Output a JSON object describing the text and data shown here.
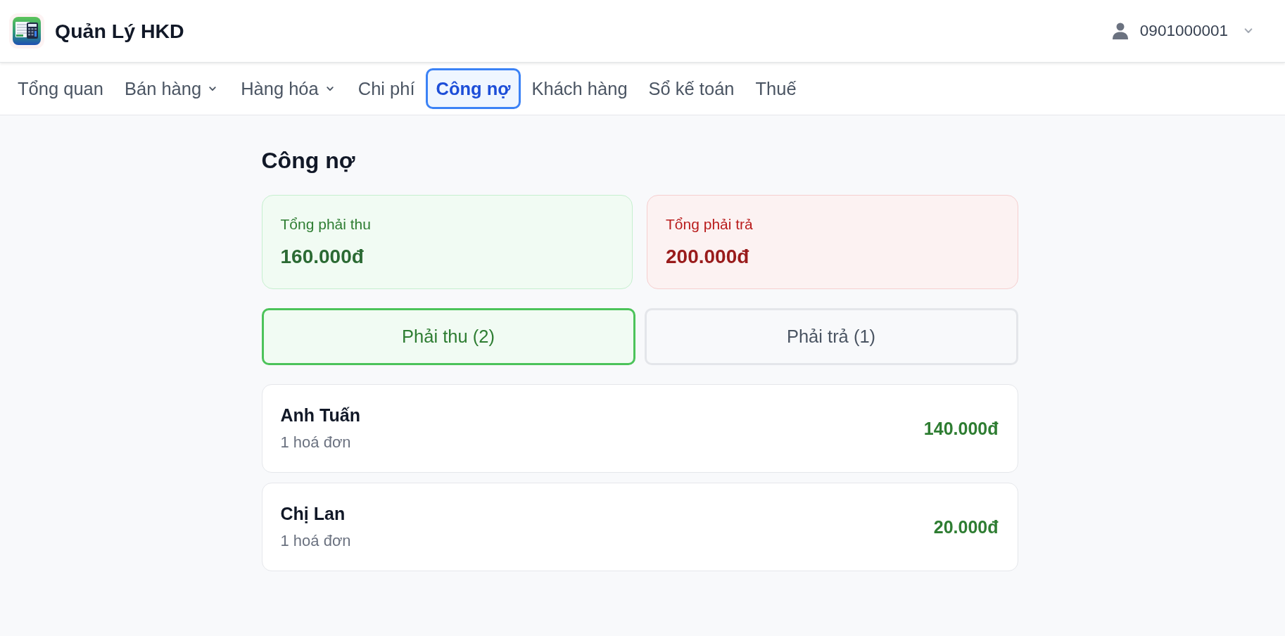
{
  "header": {
    "app_title": "Quản Lý HKD",
    "user": {
      "phone": "0901000001"
    }
  },
  "nav": {
    "items": [
      {
        "label": "Tổng quan",
        "selected": false,
        "has_menu": false
      },
      {
        "label": "Bán hàng",
        "selected": false,
        "has_menu": true
      },
      {
        "label": "Hàng hóa",
        "selected": false,
        "has_menu": true
      },
      {
        "label": "Chi phí",
        "selected": false,
        "has_menu": false
      },
      {
        "label": "Công nợ",
        "selected": true,
        "has_menu": false
      },
      {
        "label": "Khách hàng",
        "selected": false,
        "has_menu": false
      },
      {
        "label": "Sổ kế toán",
        "selected": false,
        "has_menu": false
      },
      {
        "label": "Thuế",
        "selected": false,
        "has_menu": false
      }
    ]
  },
  "page": {
    "title": "Công nợ"
  },
  "summary_cards": [
    {
      "kind": "receivable",
      "label": "Tổng phải thu",
      "value": "160.000đ"
    },
    {
      "kind": "payable",
      "label": "Tổng phải trả",
      "value": "200.000đ"
    }
  ],
  "tabs": [
    {
      "label": "Phải thu (2)",
      "selected": true
    },
    {
      "label": "Phải trả (1)",
      "selected": false
    }
  ],
  "debtors": [
    {
      "name": "Anh Tuấn",
      "invoices": "1 hoá đơn",
      "amount": "140.000đ"
    },
    {
      "name": "Chị Lan",
      "invoices": "1 hoá đơn",
      "amount": "20.000đ"
    }
  ]
}
